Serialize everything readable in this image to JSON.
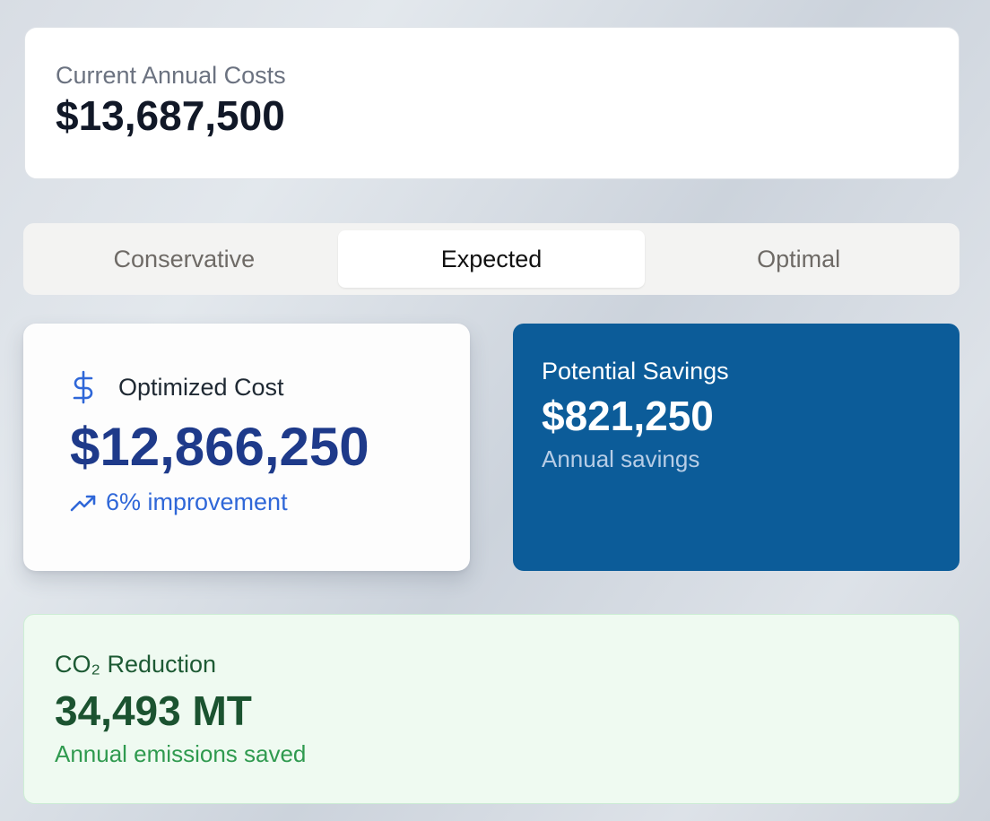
{
  "current": {
    "label": "Current Annual Costs",
    "value": "$13,687,500"
  },
  "tabs": [
    {
      "label": "Conservative",
      "active": false
    },
    {
      "label": "Expected",
      "active": true
    },
    {
      "label": "Optimal",
      "active": false
    }
  ],
  "optimized": {
    "icon": "dollar-sign-icon",
    "label": "Optimized Cost",
    "value": "$12,866,250",
    "trend_icon": "trending-up-icon",
    "trend_text": "6% improvement"
  },
  "savings": {
    "label": "Potential Savings",
    "value": "$821,250",
    "sub": "Annual savings"
  },
  "co2": {
    "label": "CO₂ Reduction",
    "value": "34,493 MT",
    "sub": "Annual emissions saved"
  },
  "colors": {
    "savings_bg": "#0c5c99",
    "optimized_value": "#1e3a8a",
    "trend": "#2f67d8",
    "co2_bg": "#effaf1",
    "co2_text": "#1b5330",
    "co2_sub": "#2f9a4f"
  }
}
